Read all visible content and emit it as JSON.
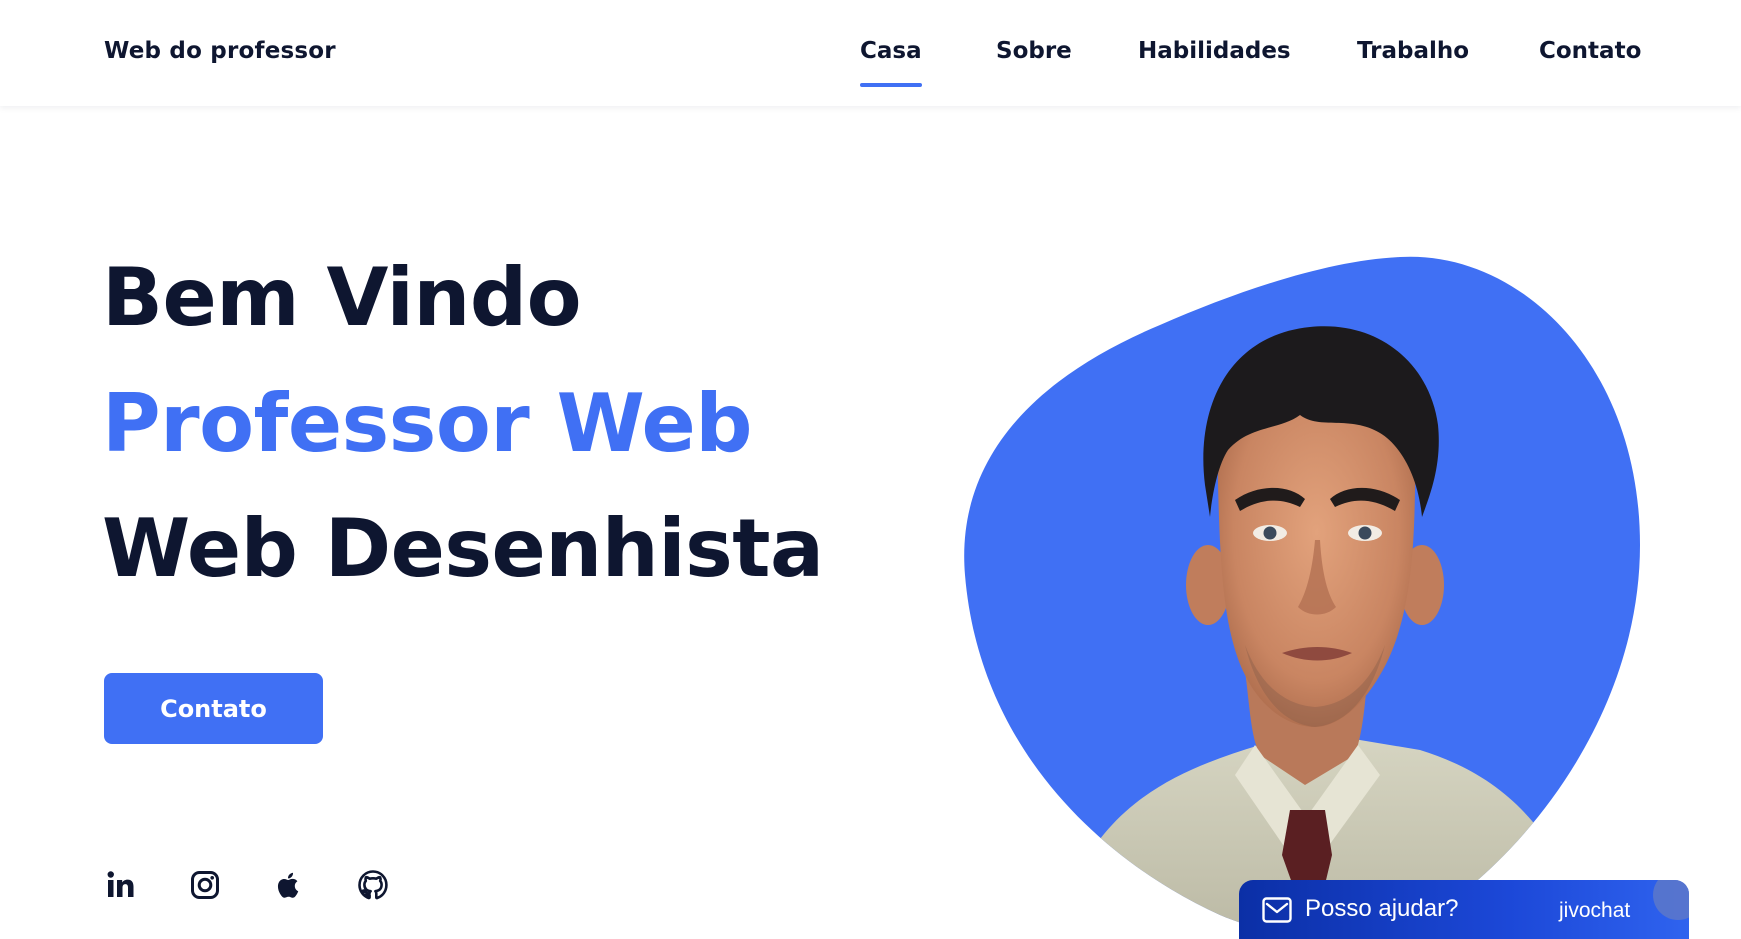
{
  "header": {
    "logo": "Web do professor",
    "nav": [
      {
        "label": "Casa",
        "active": true
      },
      {
        "label": "Sobre",
        "active": false
      },
      {
        "label": "Habilidades",
        "active": false
      },
      {
        "label": "Trabalho",
        "active": false
      },
      {
        "label": "Contato",
        "active": false
      }
    ]
  },
  "hero": {
    "line1": "Bem Vindo",
    "line2": "Professor Web",
    "line3": "Web Desenhista",
    "cta_label": "Contato"
  },
  "socials": [
    {
      "name": "linkedin-icon"
    },
    {
      "name": "instagram-icon"
    },
    {
      "name": "apple-icon"
    },
    {
      "name": "github-icon"
    }
  ],
  "portrait": {
    "alt": "professor portrait illustration"
  },
  "chat": {
    "label": "Posso ajudar?",
    "brand": "jivochat"
  },
  "colors": {
    "accent": "#4070f4",
    "text_dark": "#0e1630",
    "chat_bg": "#1c48d8"
  }
}
